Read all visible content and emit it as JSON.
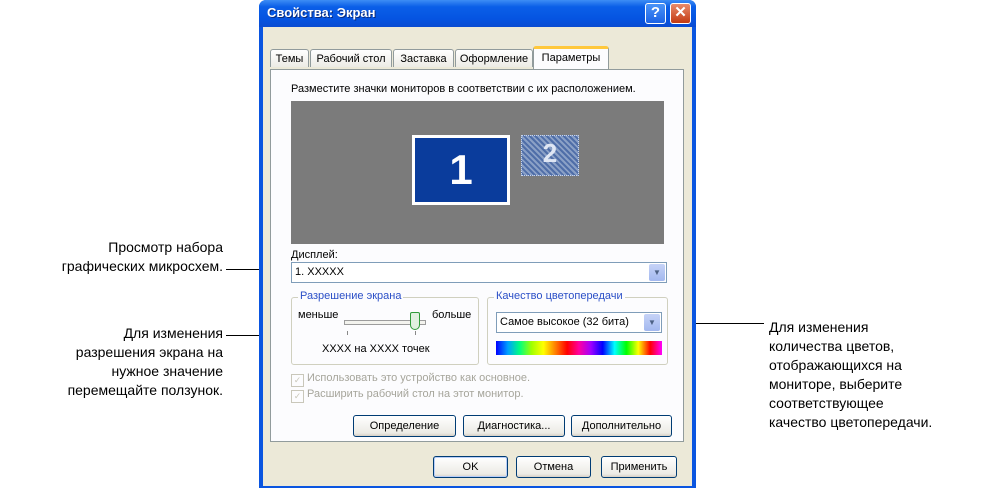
{
  "window": {
    "title": "Свойства: Экран",
    "help_label": "?",
    "close_label": "✕"
  },
  "tabs": [
    "Темы",
    "Рабочий стол",
    "Заставка",
    "Оформление",
    "Параметры"
  ],
  "instruction": "Разместите значки мониторов в соответствии с их расположением.",
  "monitors": {
    "primary": "1",
    "secondary": "2"
  },
  "display": {
    "label": "Дисплей:",
    "value": "1. XXXXX"
  },
  "resolution": {
    "legend": "Разрешение экрана",
    "less": "меньше",
    "more": "больше",
    "value_text": "XXXX на XXXX  точек",
    "slider_level_percent": 85
  },
  "color_quality": {
    "legend": "Качество цветопередачи",
    "value": "Самое высокое (32 бита)"
  },
  "checkboxes": [
    {
      "label": "Использовать это устройство как основное.",
      "checked": true,
      "enabled": false
    },
    {
      "label": "Расширить рабочий стол на этот монитор.",
      "checked": true,
      "enabled": false
    }
  ],
  "buttons": {
    "identify": "Определение",
    "troubleshoot": "Диагностика...",
    "advanced": "Дополнительно",
    "ok": "OK",
    "cancel": "Отмена",
    "apply": "Применить"
  },
  "callouts": {
    "chipset": [
      "Просмотр набора",
      "графических микросхем."
    ],
    "resolution": [
      "Для изменения",
      "разрешения экрана на",
      "нужное значение",
      "перемещайте ползунок."
    ],
    "colors": [
      "Для изменения",
      "количества цветов,",
      "отображающихся на",
      "мониторе, выберите",
      "соответствующее",
      "качество цветопередачи."
    ]
  },
  "colors": {
    "title_bar": "#0554e1",
    "tab_highlight": "#ffc83c",
    "dialog_bg": "#ece9d8",
    "preview_bg": "#7b7b7b",
    "monitor_primary": "#0a3c9c"
  }
}
